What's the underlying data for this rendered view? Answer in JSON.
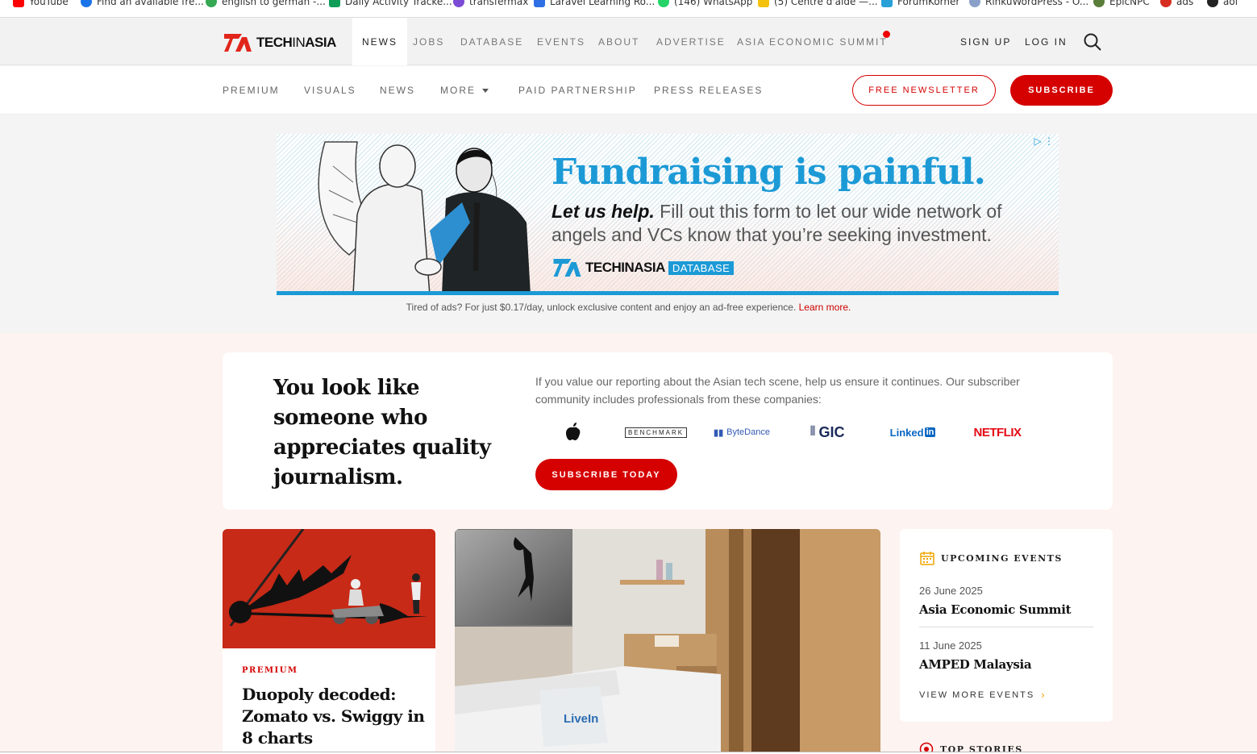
{
  "bookmarks": [
    {
      "label": "YouTube",
      "color": "#ff0000"
    },
    {
      "label": "Find an available fre...",
      "color": "#1a73e8"
    },
    {
      "label": "english to german -...",
      "color": "#34a853"
    },
    {
      "label": "Daily Activity Tracke...",
      "color": "#0f9d58"
    },
    {
      "label": "transfermax",
      "color": "#7b4bd6"
    },
    {
      "label": "Laravel Learning Ro...",
      "color": "#2f6fe4"
    },
    {
      "label": "(146) WhatsApp",
      "color": "#25d366"
    },
    {
      "label": "(5) Centre d'aide —...",
      "color": "#f4c20d"
    },
    {
      "label": "ForumKorner",
      "color": "#2aa0d8"
    },
    {
      "label": "RinkuWordPress - O...",
      "color": "#8aa0c8"
    },
    {
      "label": "EpicNPC",
      "color": "#5a7d3a"
    },
    {
      "label": "ads",
      "color": "#d62d20"
    },
    {
      "label": "aol",
      "color": "#222222"
    }
  ],
  "header": {
    "logo_bold": "TECH",
    "logo_thin": "IN",
    "logo_bold2": "ASIA",
    "nav": [
      "NEWS",
      "JOBS",
      "DATABASE",
      "EVENTS",
      "ABOUT",
      "ADVERTISE",
      "ASIA ECONOMIC SUMMIT"
    ],
    "sign_up": "SIGN UP",
    "log_in": "LOG IN"
  },
  "subnav": {
    "items": [
      "PREMIUM",
      "VISUALS",
      "NEWS",
      "MORE",
      "PAID PARTNERSHIP",
      "PRESS RELEASES"
    ],
    "newsletter": "FREE NEWSLETTER",
    "subscribe": "SUBSCRIBE"
  },
  "ad": {
    "headline": "Fundraising is painful.",
    "lead": "Let us help.",
    "body": " Fill out this form to let our wide network of angels and VCs know that you’re seeking investment.",
    "brand": "TECHINASIA",
    "brand_tag": "DATABASE",
    "note": "Tired of ads? For just $0.17/day, unlock exclusive content and enjoy an ad-free experience.",
    "note_link": "Learn more."
  },
  "promo": {
    "title": "You look like someone who appreciates quality journalism.",
    "text": "If you value our reporting about the Asian tech scene, help us ensure it continues. Our subscriber community includes professionals from these companies:",
    "companies": [
      "BENCHMARK",
      "ByteDance",
      "GIC",
      "Linked",
      "in",
      "NETFLIX"
    ],
    "button": "SUBSCRIBE TODAY"
  },
  "article": {
    "kicker": "PREMIUM",
    "title": "Duopoly decoded: Zomato vs. Swiggy in 8 charts",
    "pillow_text": "LiveIn"
  },
  "events": {
    "heading": "UPCOMING EVENTS",
    "items": [
      {
        "date": "26 June 2025",
        "name": "Asia Economic Summit"
      },
      {
        "date": "11 June 2025",
        "name": "AMPED Malaysia"
      }
    ],
    "more": "VIEW MORE EVENTS",
    "top_stories": "TOP STORIES"
  },
  "colors": {
    "brand_red": "#d50000",
    "ad_blue": "#1c9ad6"
  }
}
